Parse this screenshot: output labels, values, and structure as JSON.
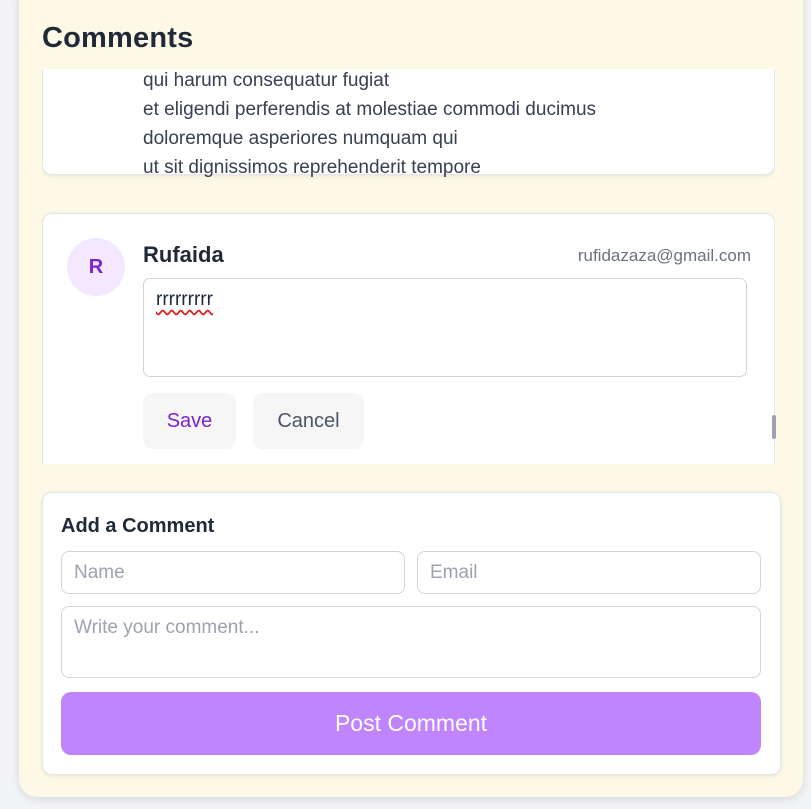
{
  "page": {
    "title": "Comments"
  },
  "previous_comment": {
    "lines": [
      "qui harum consequatur fugiat",
      "et eligendi perferendis at molestiae commodi ducimus",
      "doloremque asperiores numquam qui",
      "ut sit dignissimos reprehenderit tempore"
    ]
  },
  "editing_comment": {
    "avatar_letter": "R",
    "name": "Rufaida",
    "email": "rufidazaza@gmail.com",
    "text": "rrrrrrrrr",
    "save_label": "Save",
    "cancel_label": "Cancel"
  },
  "add_comment": {
    "title": "Add a Comment",
    "name_placeholder": "Name",
    "email_placeholder": "Email",
    "comment_placeholder": "Write your comment...",
    "post_label": "Post Comment"
  },
  "colors": {
    "panel_bg": "#fef9e7",
    "accent": "#7e22ce",
    "post_button": "#c084fc",
    "avatar_bg": "#f3e8ff"
  }
}
